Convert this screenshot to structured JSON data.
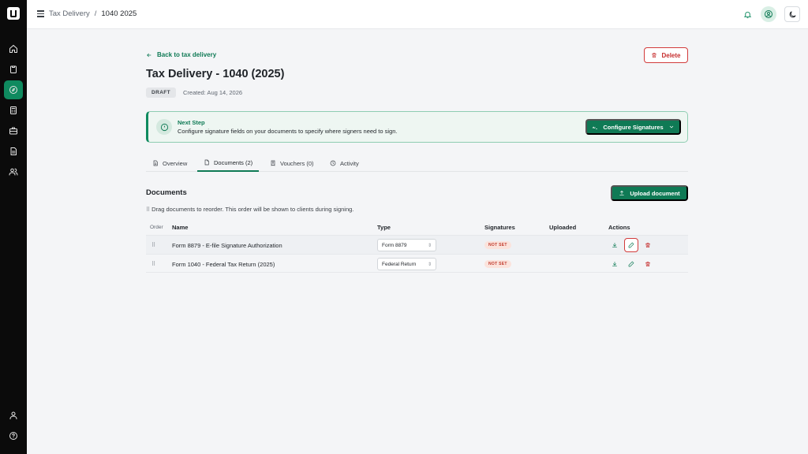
{
  "breadcrumb": {
    "parent": "Tax Delivery",
    "separator": "/",
    "current": "1040 2025"
  },
  "page": {
    "back_label": "Back to tax delivery",
    "delete_label": "Delete",
    "title": "Tax Delivery - 1040 (2025)",
    "status": "DRAFT",
    "created": "Created: Aug 14, 2026"
  },
  "next_step": {
    "title": "Next Step",
    "text": "Configure signature fields on your documents to specify where signers need to sign.",
    "button_label": "Configure Signatures"
  },
  "tabs": [
    {
      "label": "Overview"
    },
    {
      "label": "Documents (2)"
    },
    {
      "label": "Vouchers (0)"
    },
    {
      "label": "Activity"
    }
  ],
  "documents": {
    "title": "Documents",
    "upload_label": "Upload document",
    "hint": "Drag documents to reorder. This order will be shown to clients during signing.",
    "headers": {
      "order": "Order",
      "name": "Name",
      "type": "Type",
      "signatures": "Signatures",
      "uploaded": "Uploaded",
      "actions": "Actions"
    },
    "rows": [
      {
        "name": "Form 8879 - E-file Signature Authorization",
        "type": "Form 8879",
        "signatures": "NOT SET",
        "uploaded": ""
      },
      {
        "name": "Form 1040 - Federal Tax Return (2025)",
        "type": "Federal Return",
        "signatures": "NOT SET",
        "uploaded": ""
      }
    ]
  },
  "colors": {
    "accent": "#0f7a55",
    "danger": "#c62f2f",
    "sidebar": "#0b0b0b"
  },
  "icons": {
    "sidebar": [
      "home-icon",
      "clipboard-icon",
      "compass-icon",
      "calculator-icon",
      "briefcase-icon",
      "document-icon",
      "users-icon",
      "user-icon",
      "help-icon"
    ],
    "topbar": [
      "menu-icon",
      "bell-icon",
      "user-circle-icon",
      "moon-icon"
    ]
  }
}
